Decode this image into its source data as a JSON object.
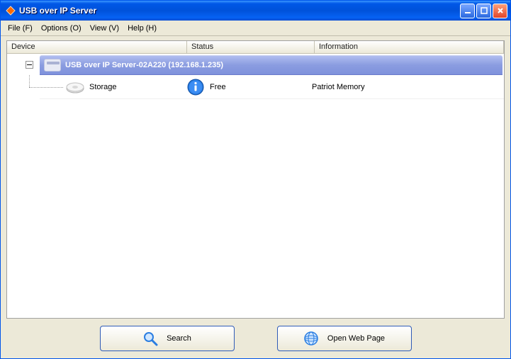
{
  "window": {
    "title": "USB over IP Server"
  },
  "menu": {
    "file": "File (F)",
    "options": "Options (O)",
    "view": "View (V)",
    "help": "Help (H)"
  },
  "columns": {
    "device": "Device",
    "status": "Status",
    "information": "Information"
  },
  "server": {
    "label": "USB over IP Server-02A220  (192.168.1.235)"
  },
  "device": {
    "name": "Storage",
    "status": "Free",
    "info": "Patriot Memory"
  },
  "buttons": {
    "search": "Search",
    "open_web": "Open Web Page"
  }
}
